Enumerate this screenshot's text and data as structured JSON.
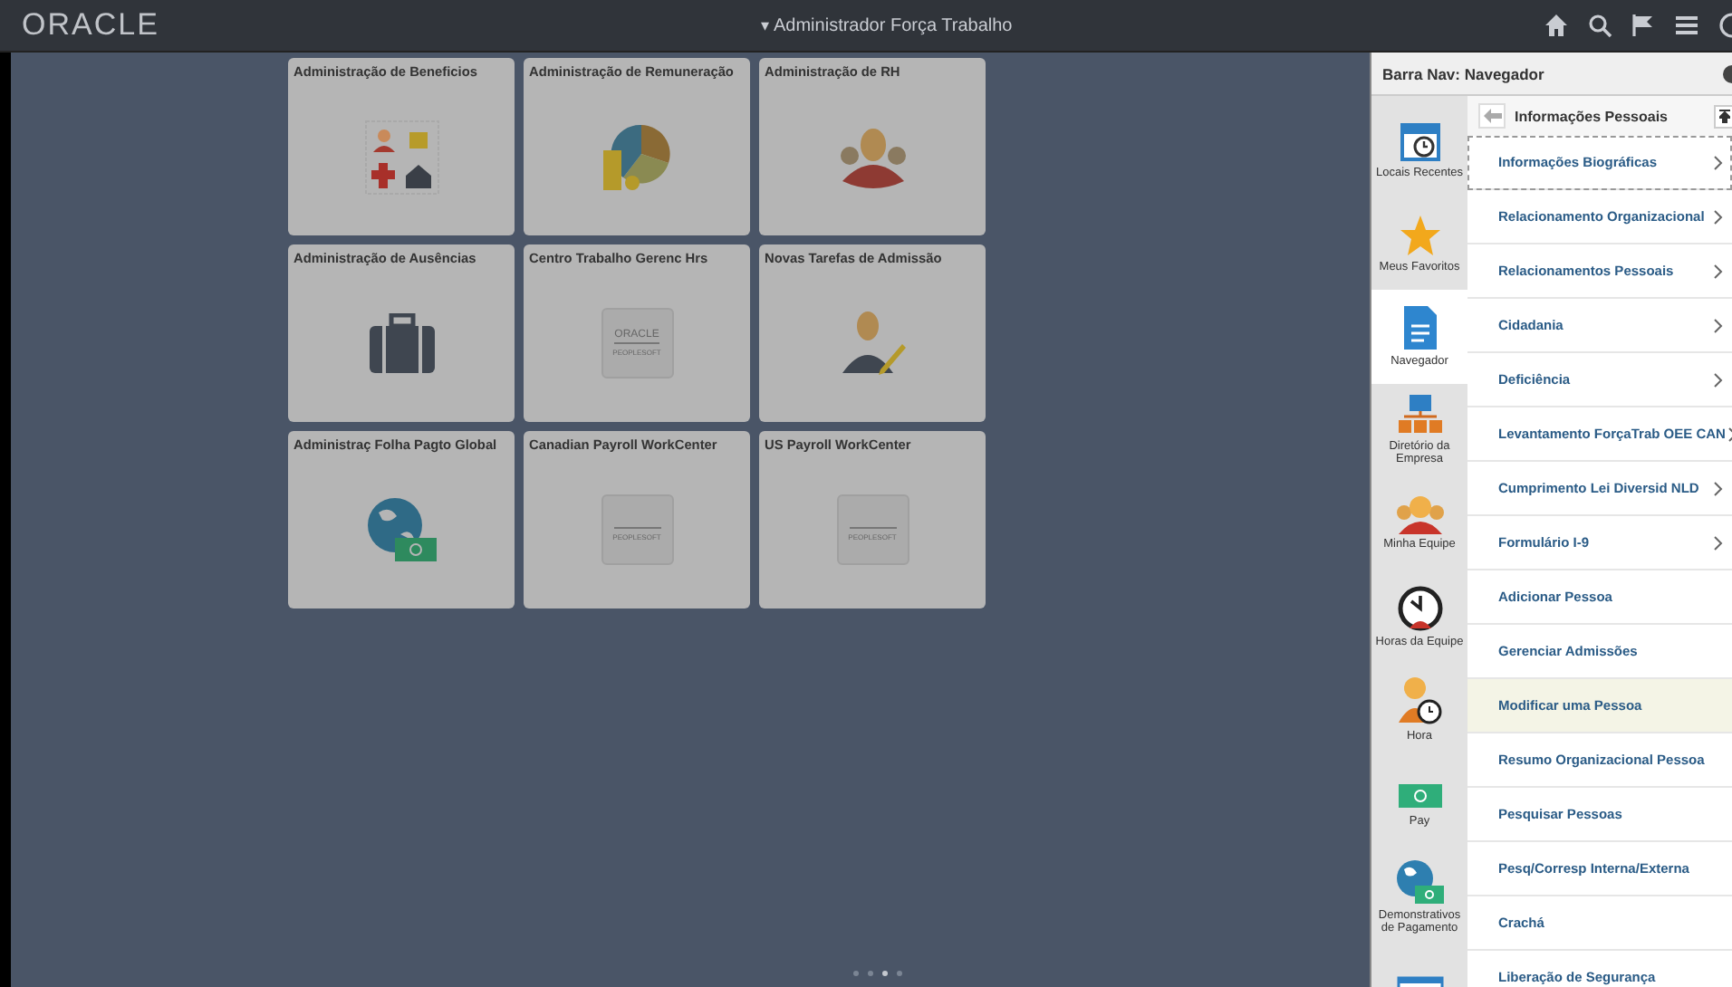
{
  "header": {
    "logo": "ORACLE",
    "caret": "▾",
    "title": "Administrador Força Trabalho"
  },
  "tiles": [
    {
      "title": "Administração de Beneficios",
      "kind": "benefits"
    },
    {
      "title": "Administração de Remuneração",
      "kind": "pie"
    },
    {
      "title": "Administração de RH",
      "kind": "people"
    },
    {
      "title": "Administração de Ausências",
      "kind": "briefcase"
    },
    {
      "title": "Centro Trabalho Gerenc Hrs",
      "kind": "logo",
      "logo_brand": "ORACLE",
      "logo_product": "PEOPLESOFT"
    },
    {
      "title": "Novas Tarefas de Admissão",
      "kind": "person"
    },
    {
      "title": "Administraç Folha Pagto Global",
      "kind": "globe"
    },
    {
      "title": "Canadian Payroll WorkCenter",
      "kind": "logo",
      "logo_product": "PEOPLESOFT"
    },
    {
      "title": "US Payroll WorkCenter",
      "kind": "logo",
      "logo_product": "PEOPLESOFT"
    }
  ],
  "page_dots": [
    {
      "selected": false
    },
    {
      "selected": false
    },
    {
      "selected": true
    },
    {
      "selected": false
    }
  ],
  "nav": {
    "title": "Barra Nav: Navegador",
    "folder": "Informações Pessoais",
    "side_items": [
      {
        "label": "Locais Recentes",
        "kind": "recent",
        "selected": false
      },
      {
        "label": "Meus Favoritos",
        "kind": "favorites",
        "selected": false
      },
      {
        "label": "Navegador",
        "kind": "navigator",
        "selected": true
      },
      {
        "label": "Diretório da Empresa",
        "kind": "directory",
        "selected": false
      },
      {
        "label": "Minha Equipe",
        "kind": "team",
        "selected": false
      },
      {
        "label": "Horas da Equipe",
        "kind": "teamtime",
        "selected": false
      },
      {
        "label": "Hora",
        "kind": "time",
        "selected": false
      },
      {
        "label": "Pay",
        "kind": "pay",
        "selected": false
      },
      {
        "label": "Demonstrativos de Pagamento",
        "kind": "payslip",
        "selected": false
      },
      {
        "kind": "window",
        "selected": false
      }
    ],
    "items": [
      {
        "label": "Informações Biográficas",
        "expandable": true,
        "focused": true,
        "selected": false
      },
      {
        "label": "Relacionamento Organizacional",
        "expandable": true,
        "focused": false,
        "selected": false
      },
      {
        "label": "Relacionamentos Pessoais",
        "expandable": true,
        "focused": false,
        "selected": false
      },
      {
        "label": "Cidadania",
        "expandable": true,
        "focused": false,
        "selected": false
      },
      {
        "label": "Deficiência",
        "expandable": true,
        "focused": false,
        "selected": false
      },
      {
        "label": "Levantamento ForçaTrab OEE CAN",
        "expandable": true,
        "focused": false,
        "selected": false
      },
      {
        "label": "Cumprimento Lei Diversid NLD",
        "expandable": true,
        "focused": false,
        "selected": false
      },
      {
        "label": "Formulário I-9",
        "expandable": true,
        "focused": false,
        "selected": false
      },
      {
        "label": "Adicionar Pessoa",
        "expandable": false,
        "focused": false,
        "selected": false
      },
      {
        "label": "Gerenciar Admissões",
        "expandable": false,
        "focused": false,
        "selected": false
      },
      {
        "label": "Modificar uma Pessoa",
        "expandable": false,
        "focused": false,
        "selected": true
      },
      {
        "label": "Resumo Organizacional Pessoa",
        "expandable": false,
        "focused": false,
        "selected": false
      },
      {
        "label": "Pesquisar Pessoas",
        "expandable": false,
        "focused": false,
        "selected": false
      },
      {
        "label": "Pesq/Corresp Interna/Externa",
        "expandable": false,
        "focused": false,
        "selected": false
      },
      {
        "label": "Crachá",
        "expandable": false,
        "focused": false,
        "selected": false
      },
      {
        "label": "Liberação de Segurança",
        "expandable": false,
        "focused": false,
        "selected": false
      }
    ]
  }
}
